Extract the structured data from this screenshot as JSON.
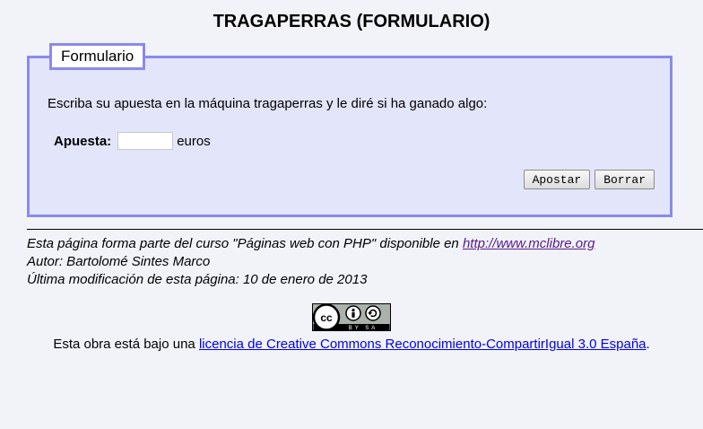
{
  "page": {
    "title": "TRAGAPERRAS (FORMULARIO)"
  },
  "form": {
    "legend": "Formulario",
    "intro": "Escriba su apuesta en la máquina tragaperras y le diré si ha ganado algo:",
    "bet_label": "Apuesta:",
    "bet_value": "",
    "bet_unit": "euros",
    "submit_label": "Apostar",
    "reset_label": "Borrar"
  },
  "footer": {
    "course_prefix": "Esta página forma parte del curso \"Páginas web con PHP\" disponible en ",
    "course_link": "http://www.mclibre.org",
    "author": "Autor: Bartolomé Sintes Marco",
    "modified": "Última modificación de esta página: 10 de enero de 2013",
    "cc_badge_text": "BY SA",
    "license_prefix": "Esta obra está bajo una ",
    "license_link": "licencia de Creative Commons Reconocimiento-CompartirIgual 3.0 España",
    "license_suffix": "."
  },
  "colors": {
    "fieldset_border": "#8a8aee",
    "fieldset_bg": "#e3e5fb",
    "page_bg": "#f1f3f9"
  }
}
